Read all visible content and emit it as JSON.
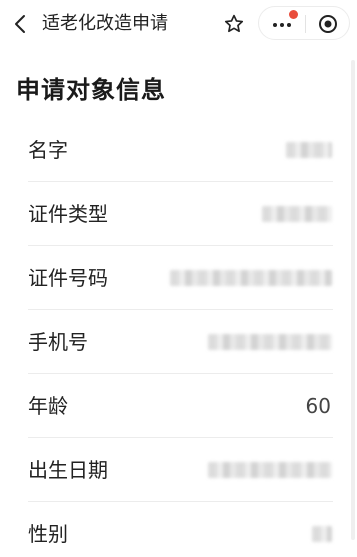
{
  "navbar": {
    "title": "适老化改造申请",
    "icons": {
      "back": "chevron-left-icon",
      "favorite": "star-outline-icon",
      "more": "more-dots-icon",
      "close": "target-circle-icon"
    },
    "notification_dot_color": "#e94d3c"
  },
  "section": {
    "title": "申请对象信息"
  },
  "fields": {
    "name": {
      "label": "名字",
      "value": ""
    },
    "id_type": {
      "label": "证件类型",
      "value": ""
    },
    "id_number": {
      "label": "证件号码",
      "value": ""
    },
    "phone": {
      "label": "手机号",
      "value": ""
    },
    "age": {
      "label": "年龄",
      "value": "60"
    },
    "birth_date": {
      "label": "出生日期",
      "value": ""
    },
    "gender": {
      "label": "性别",
      "value": ""
    }
  }
}
